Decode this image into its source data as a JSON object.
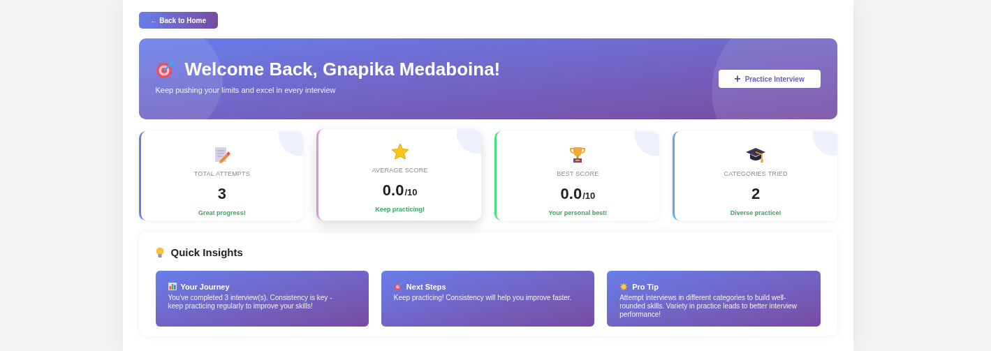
{
  "back_button": {
    "label": "← Back to Home"
  },
  "hero": {
    "title": "Welcome Back, Gnapika Medaboina!",
    "subtitle": "Keep pushing your limits and excel in every interview",
    "action": {
      "icon": "+",
      "label": "Practice Interview"
    }
  },
  "stats": [
    {
      "kind": "document",
      "label": "TOTAL ATTEMPTS",
      "value": "3",
      "note": "Great progress!",
      "color": "#667eea",
      "hovered": false
    },
    {
      "kind": "star",
      "label": "AVERAGE SCORE",
      "value": "0.0",
      "unit": "/10",
      "note": "Keep practicing!",
      "color": "#e28cf0",
      "hovered": true
    },
    {
      "kind": "trophy",
      "label": "BEST SCORE",
      "value": "0.0",
      "unit": "/10",
      "note": "Your personal best!",
      "color": "#4ade80",
      "hovered": false
    },
    {
      "kind": "cap",
      "label": "CATEGORIES TRIED",
      "value": "2",
      "note": "Diverse practice!",
      "color": "#5aabf5",
      "hovered": false
    }
  ],
  "insights": {
    "title": "Quick Insights",
    "cards": [
      {
        "kind": "chart",
        "title": "Your Journey",
        "text": "You've completed 3 interview(s). Consistency is key - keep practicing regularly to improve your skills!"
      },
      {
        "kind": "target",
        "title": "Next Steps",
        "text": "Keep practicing! Consistency will help you improve faster."
      },
      {
        "kind": "sun",
        "title": "Pro Tip",
        "text": "Attempt interviews in different categories to build well-rounded skills. Variety in practice leads to better interview performance!"
      }
    ]
  }
}
